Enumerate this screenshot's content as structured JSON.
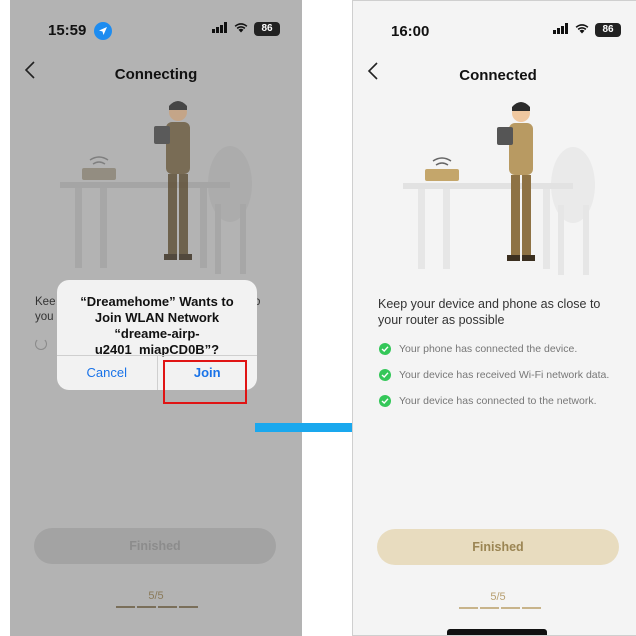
{
  "left_screen": {
    "status_time": "15:59",
    "battery": "86",
    "title": "Connecting",
    "partial_heading_1": "Kee",
    "partial_heading_2": "you",
    "partial_right": "o",
    "dialog": {
      "message": "“Dreamehome” Wants to Join WLAN Network “dreame-airp-u2401_miapCD0B”?",
      "cancel_label": "Cancel",
      "join_label": "Join"
    },
    "finish_label": "Finished",
    "step": "5/5"
  },
  "right_screen": {
    "status_time": "16:00",
    "battery": "86",
    "title": "Connected",
    "heading": "Keep your device and phone as close to your router as possible",
    "status_items": [
      "Your phone has connected the device.",
      "Your device has received Wi-Fi network data.",
      "Your device has connected to the network."
    ],
    "finish_label": "Finished",
    "step": "5/5"
  },
  "colors": {
    "accent_gold": "#e8dcbf",
    "check_green": "#34c759",
    "ios_blue": "#1a73e8",
    "highlight_red": "#e01414",
    "arrow_blue": "#1aa8ee"
  }
}
